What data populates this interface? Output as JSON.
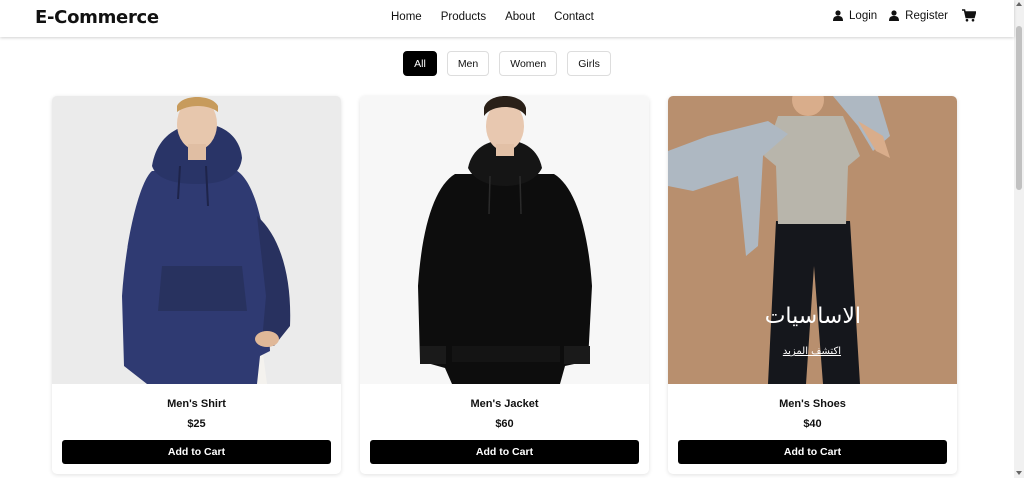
{
  "brand": "E-Commerce",
  "nav": {
    "links": [
      "Home",
      "Products",
      "About",
      "Contact"
    ],
    "login": "Login",
    "register": "Register"
  },
  "filters": [
    {
      "label": "All",
      "active": true
    },
    {
      "label": "Men",
      "active": false
    },
    {
      "label": "Women",
      "active": false
    },
    {
      "label": "Girls",
      "active": false
    }
  ],
  "products": [
    {
      "name": "Men's Shirt",
      "price": "$25",
      "button": "Add to Cart"
    },
    {
      "name": "Men's Jacket",
      "price": "$60",
      "button": "Add to Cart"
    },
    {
      "name": "Men's Shoes",
      "price": "$40",
      "button": "Add to Cart"
    }
  ],
  "promo": {
    "title": "الاساسيات",
    "link": "اكتشف المزيد"
  },
  "colors": {
    "accent": "#000000",
    "hoodie_navy": "#2f3a72",
    "hoodie_black": "#0d0d0d",
    "promo_bg": "#b88f6e"
  }
}
